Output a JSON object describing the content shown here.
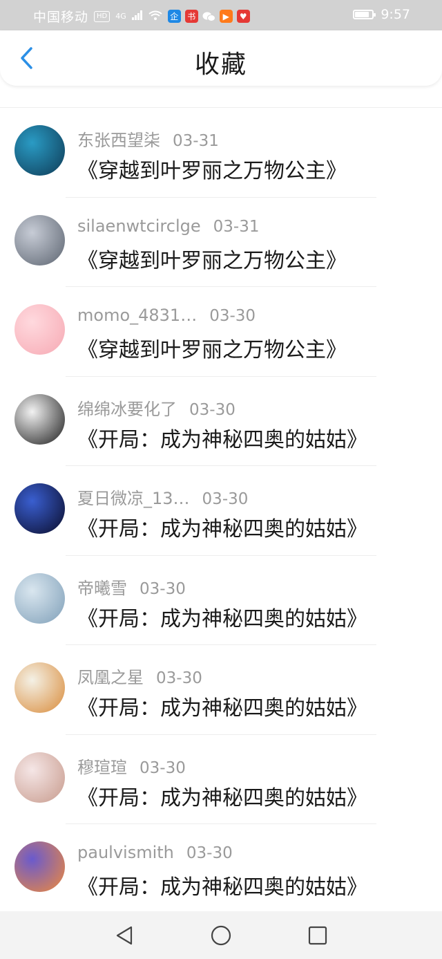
{
  "status_bar": {
    "carrier": "中国移动",
    "hd_badge": "HD",
    "network": "4G",
    "time": "9:57",
    "battery_level": 0.9,
    "app_icons": [
      {
        "icon": "qq-icon",
        "glyph": "企",
        "color": "#1e88e5"
      },
      {
        "icon": "book-icon",
        "glyph": "书",
        "color": "#e53935"
      },
      {
        "icon": "wechat-icon",
        "glyph": "",
        "color": "#ffffff"
      },
      {
        "icon": "video-icon",
        "glyph": "▶",
        "color": "#ff7a1a"
      },
      {
        "icon": "heart-app-icon",
        "glyph": "♥",
        "color": "#e53935"
      }
    ]
  },
  "header": {
    "title": "收藏",
    "back_icon": "chevron-left-icon",
    "accent": "#2b8fe6"
  },
  "items": [
    {
      "username": "东张西望柒",
      "date": "03-31",
      "book": "《穿越到叶罗丽之万物公主》",
      "avatar_colors": [
        "#2a9bc4",
        "#0e3a55"
      ]
    },
    {
      "username": "silaenwtcirclge",
      "date": "03-31",
      "book": "《穿越到叶罗丽之万物公主》",
      "avatar_colors": [
        "#c7ccd6",
        "#5c6470"
      ]
    },
    {
      "username": "momo_4831…",
      "date": "03-30",
      "book": "《穿越到叶罗丽之万物公主》",
      "avatar_colors": [
        "#ffd9de",
        "#f6a9b3"
      ]
    },
    {
      "username": "绵绵冰要化了",
      "date": "03-30",
      "book": "《开局：成为神秘四奥的姑姑》",
      "avatar_colors": [
        "#f2f2f2",
        "#1c1c1c"
      ]
    },
    {
      "username": "夏日微凉_13…",
      "date": "03-30",
      "book": "《开局：成为神秘四奥的姑姑》",
      "avatar_colors": [
        "#3a5fd0",
        "#0a0c2a"
      ]
    },
    {
      "username": "帝曦雪",
      "date": "03-30",
      "book": "《开局：成为神秘四奥的姑姑》",
      "avatar_colors": [
        "#d9e6ef",
        "#7f9fb8"
      ]
    },
    {
      "username": "凤凰之星",
      "date": "03-30",
      "book": "《开局：成为神秘四奥的姑姑》",
      "avatar_colors": [
        "#f4f1e6",
        "#d98b3a"
      ]
    },
    {
      "username": "穆瑄瑄",
      "date": "03-30",
      "book": "《开局：成为神秘四奥的姑姑》",
      "avatar_colors": [
        "#f5e6e6",
        "#c79a8c"
      ]
    },
    {
      "username": "paulvismith",
      "date": "03-30",
      "book": "《开局：成为神秘四奥的姑姑》",
      "avatar_colors": [
        "#6a5acd",
        "#f08a3a"
      ]
    }
  ],
  "nav_bar": {
    "back": "triangle-back-icon",
    "home": "circle-home-icon",
    "recents": "square-recents-icon"
  }
}
